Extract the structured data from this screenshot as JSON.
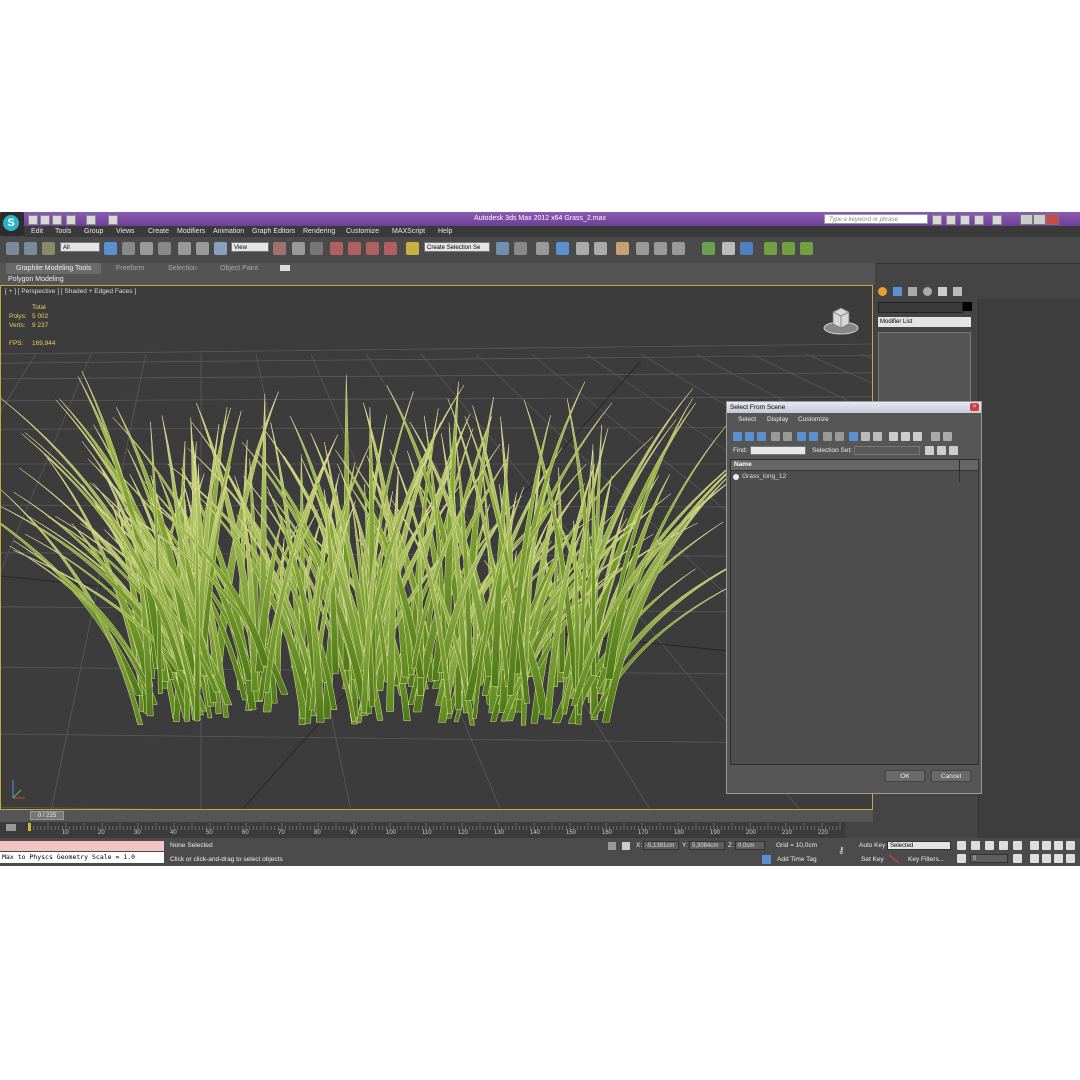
{
  "window": {
    "title": "Autodesk 3ds Max  2012 x64     Grass_2.max",
    "search_placeholder": "Type a keyword or phrase"
  },
  "menu": [
    "Edit",
    "Tools",
    "Group",
    "Views",
    "Create",
    "Modifiers",
    "Animation",
    "Graph Editors",
    "Rendering",
    "Customize",
    "MAXScript",
    "Help"
  ],
  "toolbar": {
    "filter_select": "All",
    "ref_coord": "View",
    "selection_set": "Create Selection Se"
  },
  "ribbon": {
    "tabs": [
      "Graphite Modeling Tools",
      "Freeform",
      "Selection",
      "Object Paint"
    ],
    "sub_label": "Polygon Modeling"
  },
  "viewport": {
    "label": "[ + ] [ Perspective ] [ Shaded + Edged Faces ]",
    "stats": {
      "total_label": "Total",
      "polys_label": "Polys:",
      "polys_value": "5 002",
      "verts_label": "Verts:",
      "verts_value": "9 237",
      "fps_label": "FPS:",
      "fps_value": "169,944"
    }
  },
  "command_panel": {
    "modifier_list": "Modifier List"
  },
  "dialog": {
    "title": "Select From Scene",
    "menus": [
      "Select",
      "Display",
      "Customize"
    ],
    "find_label": "Find:",
    "selection_set_label": "Selection Set:",
    "column_name": "Name",
    "items": [
      "Grass_long_12"
    ],
    "ok": "OK",
    "cancel": "Cancel"
  },
  "timeline": {
    "frame": "0 / 225",
    "ticks": [
      "10",
      "20",
      "30",
      "40",
      "50",
      "60",
      "70",
      "80",
      "90",
      "100",
      "110",
      "120",
      "130",
      "140",
      "150",
      "160",
      "170",
      "180",
      "190",
      "200",
      "210",
      "220"
    ]
  },
  "status": {
    "maxscript_output": "Max to Physcs Geometry Scale = 1.0",
    "selection": "None Selected",
    "prompt": "Click or click-and-drag to select objects",
    "x_label": "X:",
    "x_value": "-5,1381cm",
    "y_label": "Y:",
    "y_value": "5,3084cm",
    "z_label": "Z:",
    "z_value": "0,0cm",
    "grid": "Grid = 10,0cm",
    "add_time_tag": "Add Time Tag",
    "auto_key": "Auto Key",
    "set_key": "Set Key",
    "key_mode": "Selected",
    "key_filters": "Key Filters...",
    "current_frame": "0"
  }
}
